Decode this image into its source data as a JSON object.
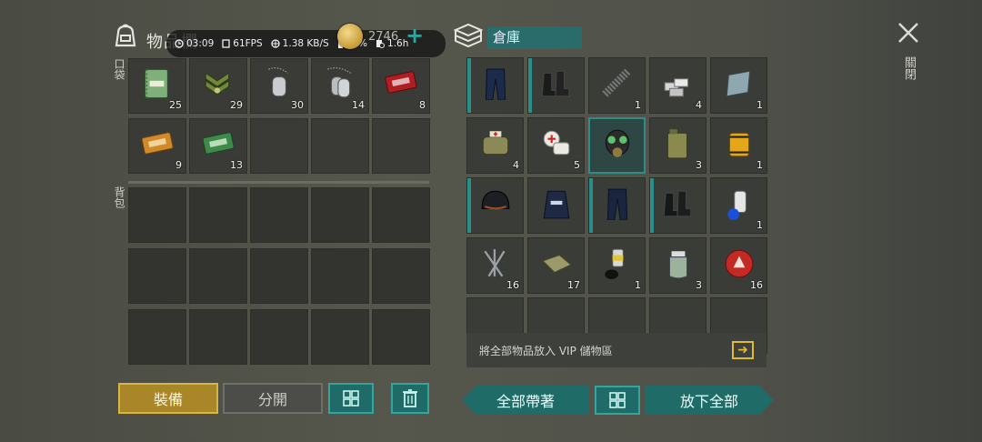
{
  "header": {
    "inventory_title": "物品欄",
    "overlay": {
      "time": "03:09",
      "fps": "61FPS",
      "net": "1.38 KB/S",
      "battery": "57%",
      "playtime": "1.6h"
    },
    "coins": "2746",
    "plus_label": "+"
  },
  "inventory": {
    "pocket_label": "口袋",
    "backpack_label": "背包",
    "pocket_items": [
      {
        "name": "notebook",
        "qty": "25"
      },
      {
        "name": "sergeant-patch",
        "qty": "29"
      },
      {
        "name": "dog-tag",
        "qty": "30"
      },
      {
        "name": "dog-tag-pair",
        "qty": "14"
      },
      {
        "name": "combat-gear-coupon",
        "qty": "8"
      },
      {
        "name": "survival-coupon",
        "qty": "9"
      },
      {
        "name": "ration-coupon",
        "qty": "13"
      },
      {
        "name": "",
        "qty": ""
      },
      {
        "name": "",
        "qty": ""
      },
      {
        "name": "",
        "qty": ""
      }
    ]
  },
  "storage": {
    "title": "倉庫",
    "vip_text": "將全部物品放入 VIP 儲物區",
    "items": [
      {
        "name": "police-pants",
        "qty": ""
      },
      {
        "name": "black-boots",
        "qty": ""
      },
      {
        "name": "spring",
        "qty": "1"
      },
      {
        "name": "silver-bars",
        "qty": "4"
      },
      {
        "name": "glass-sheet",
        "qty": "1"
      },
      {
        "name": "medic-bag",
        "qty": "4"
      },
      {
        "name": "bandages",
        "qty": "5"
      },
      {
        "name": "gas-mask",
        "qty": ""
      },
      {
        "name": "jerrycan",
        "qty": "3"
      },
      {
        "name": "oil-filter",
        "qty": "1"
      },
      {
        "name": "swat-helmet",
        "qty": ""
      },
      {
        "name": "swat-vest",
        "qty": ""
      },
      {
        "name": "swat-pants",
        "qty": ""
      },
      {
        "name": "swat-boots",
        "qty": ""
      },
      {
        "name": "spray-can",
        "qty": "1"
      },
      {
        "name": "nails",
        "qty": "16"
      },
      {
        "name": "cloth",
        "qty": "17"
      },
      {
        "name": "paint-can",
        "qty": "1"
      },
      {
        "name": "chemical-jar",
        "qty": "3"
      },
      {
        "name": "bottle-cap",
        "qty": "16"
      }
    ]
  },
  "buttons": {
    "equip": "裝備",
    "split": "分開",
    "take_all": "全部帶著",
    "drop_all": "放下全部",
    "close": "關閉"
  },
  "colors": {
    "accent": "#2a8f8a",
    "gold": "#d9b544"
  }
}
